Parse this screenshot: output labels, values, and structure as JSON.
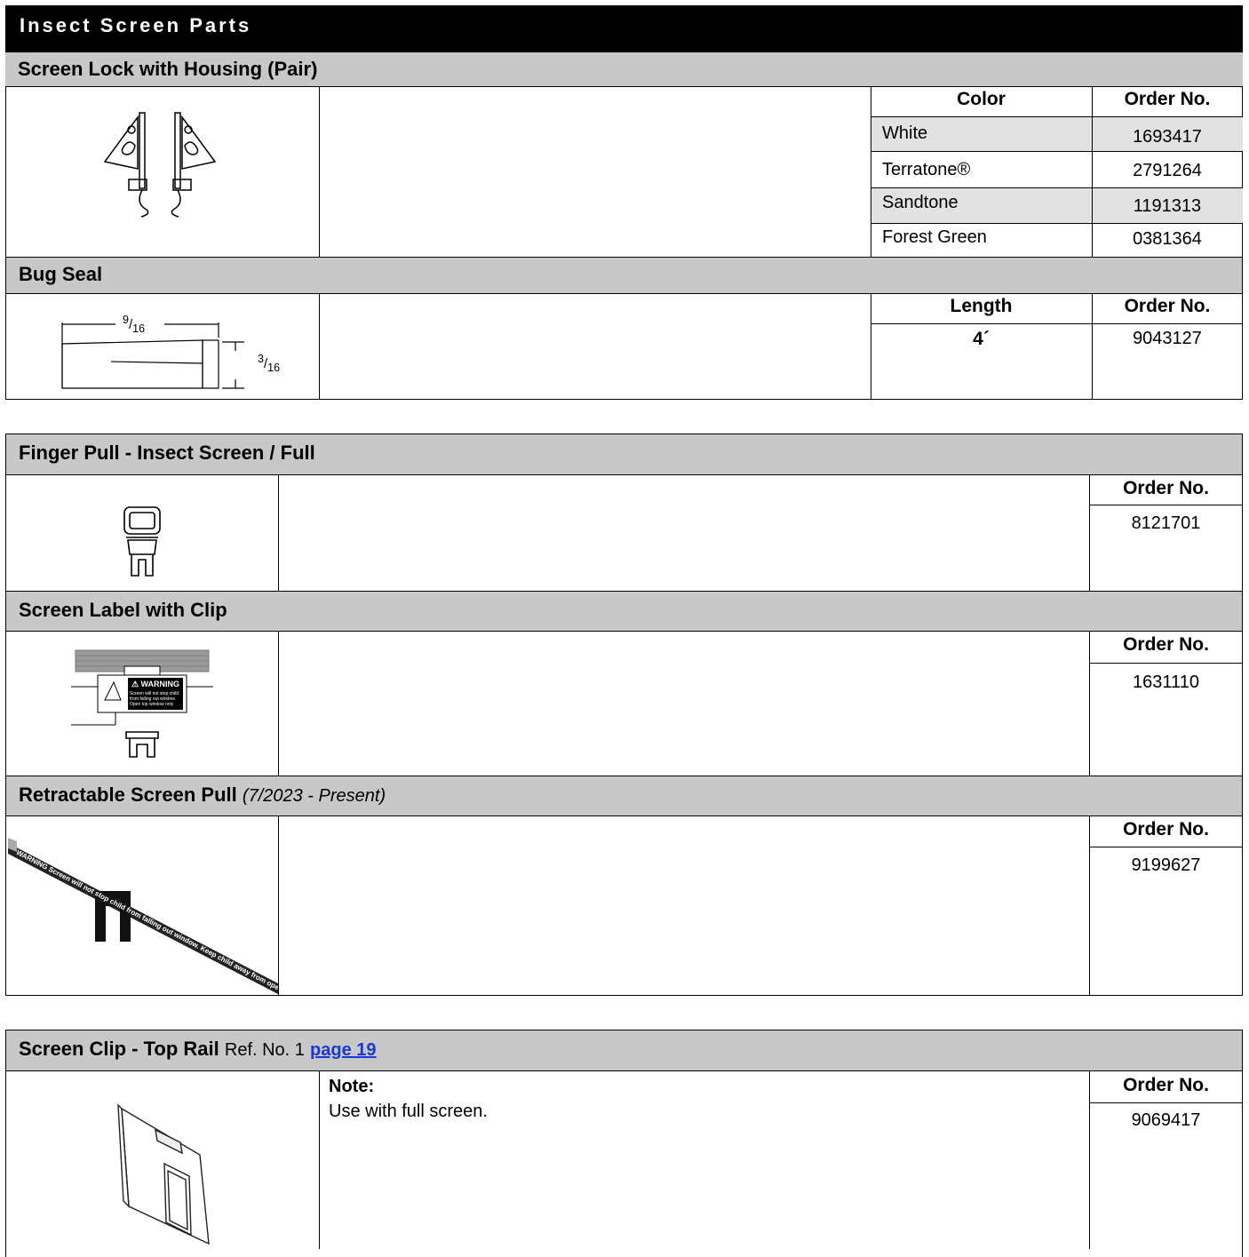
{
  "header": {
    "title": "Insect Screen Parts"
  },
  "screen_lock": {
    "title": "Screen Lock with Housing (Pair)",
    "col_color": "Color",
    "col_order": "Order No.",
    "rows": [
      {
        "color": "White",
        "order": "1693417"
      },
      {
        "color": "Terratone®",
        "order": "2791264"
      },
      {
        "color": "Sandtone",
        "order": "1191313"
      },
      {
        "color": "Forest Green",
        "order": "0381364"
      }
    ]
  },
  "bug_seal": {
    "title": "Bug Seal",
    "col_length": "Length",
    "col_order": "Order No.",
    "length": "4´",
    "order": "9043127",
    "dim_width_num": "9",
    "dim_width_den": "16",
    "dim_height_num": "3",
    "dim_height_den": "16"
  },
  "finger_pull": {
    "title": "Finger Pull - Insect Screen / Full",
    "col_order": "Order No.",
    "order": "8121701"
  },
  "screen_label": {
    "title": "Screen Label with Clip",
    "col_order": "Order No.",
    "order": "1631110",
    "label_warning": "WARNING",
    "label_line1": "Screen will not stop child",
    "label_line2": "from falling out window.",
    "label_line3": "Open top window only"
  },
  "retractable_pull": {
    "title": "Retractable Screen Pull",
    "subtitle": "(7/2023 - Present)",
    "col_order": "Order No.",
    "order": "9199627",
    "strip_text": "WARNING Screen will not stop child from falling out window. Keep child away from open window."
  },
  "screen_clip": {
    "title": "Screen Clip - Top Rail",
    "ref_text": "Ref. No. 1",
    "page_link": "page 19",
    "note_label": "Note:",
    "note_text": "Use with full screen.",
    "col_order": "Order No.",
    "order": "9069417"
  }
}
